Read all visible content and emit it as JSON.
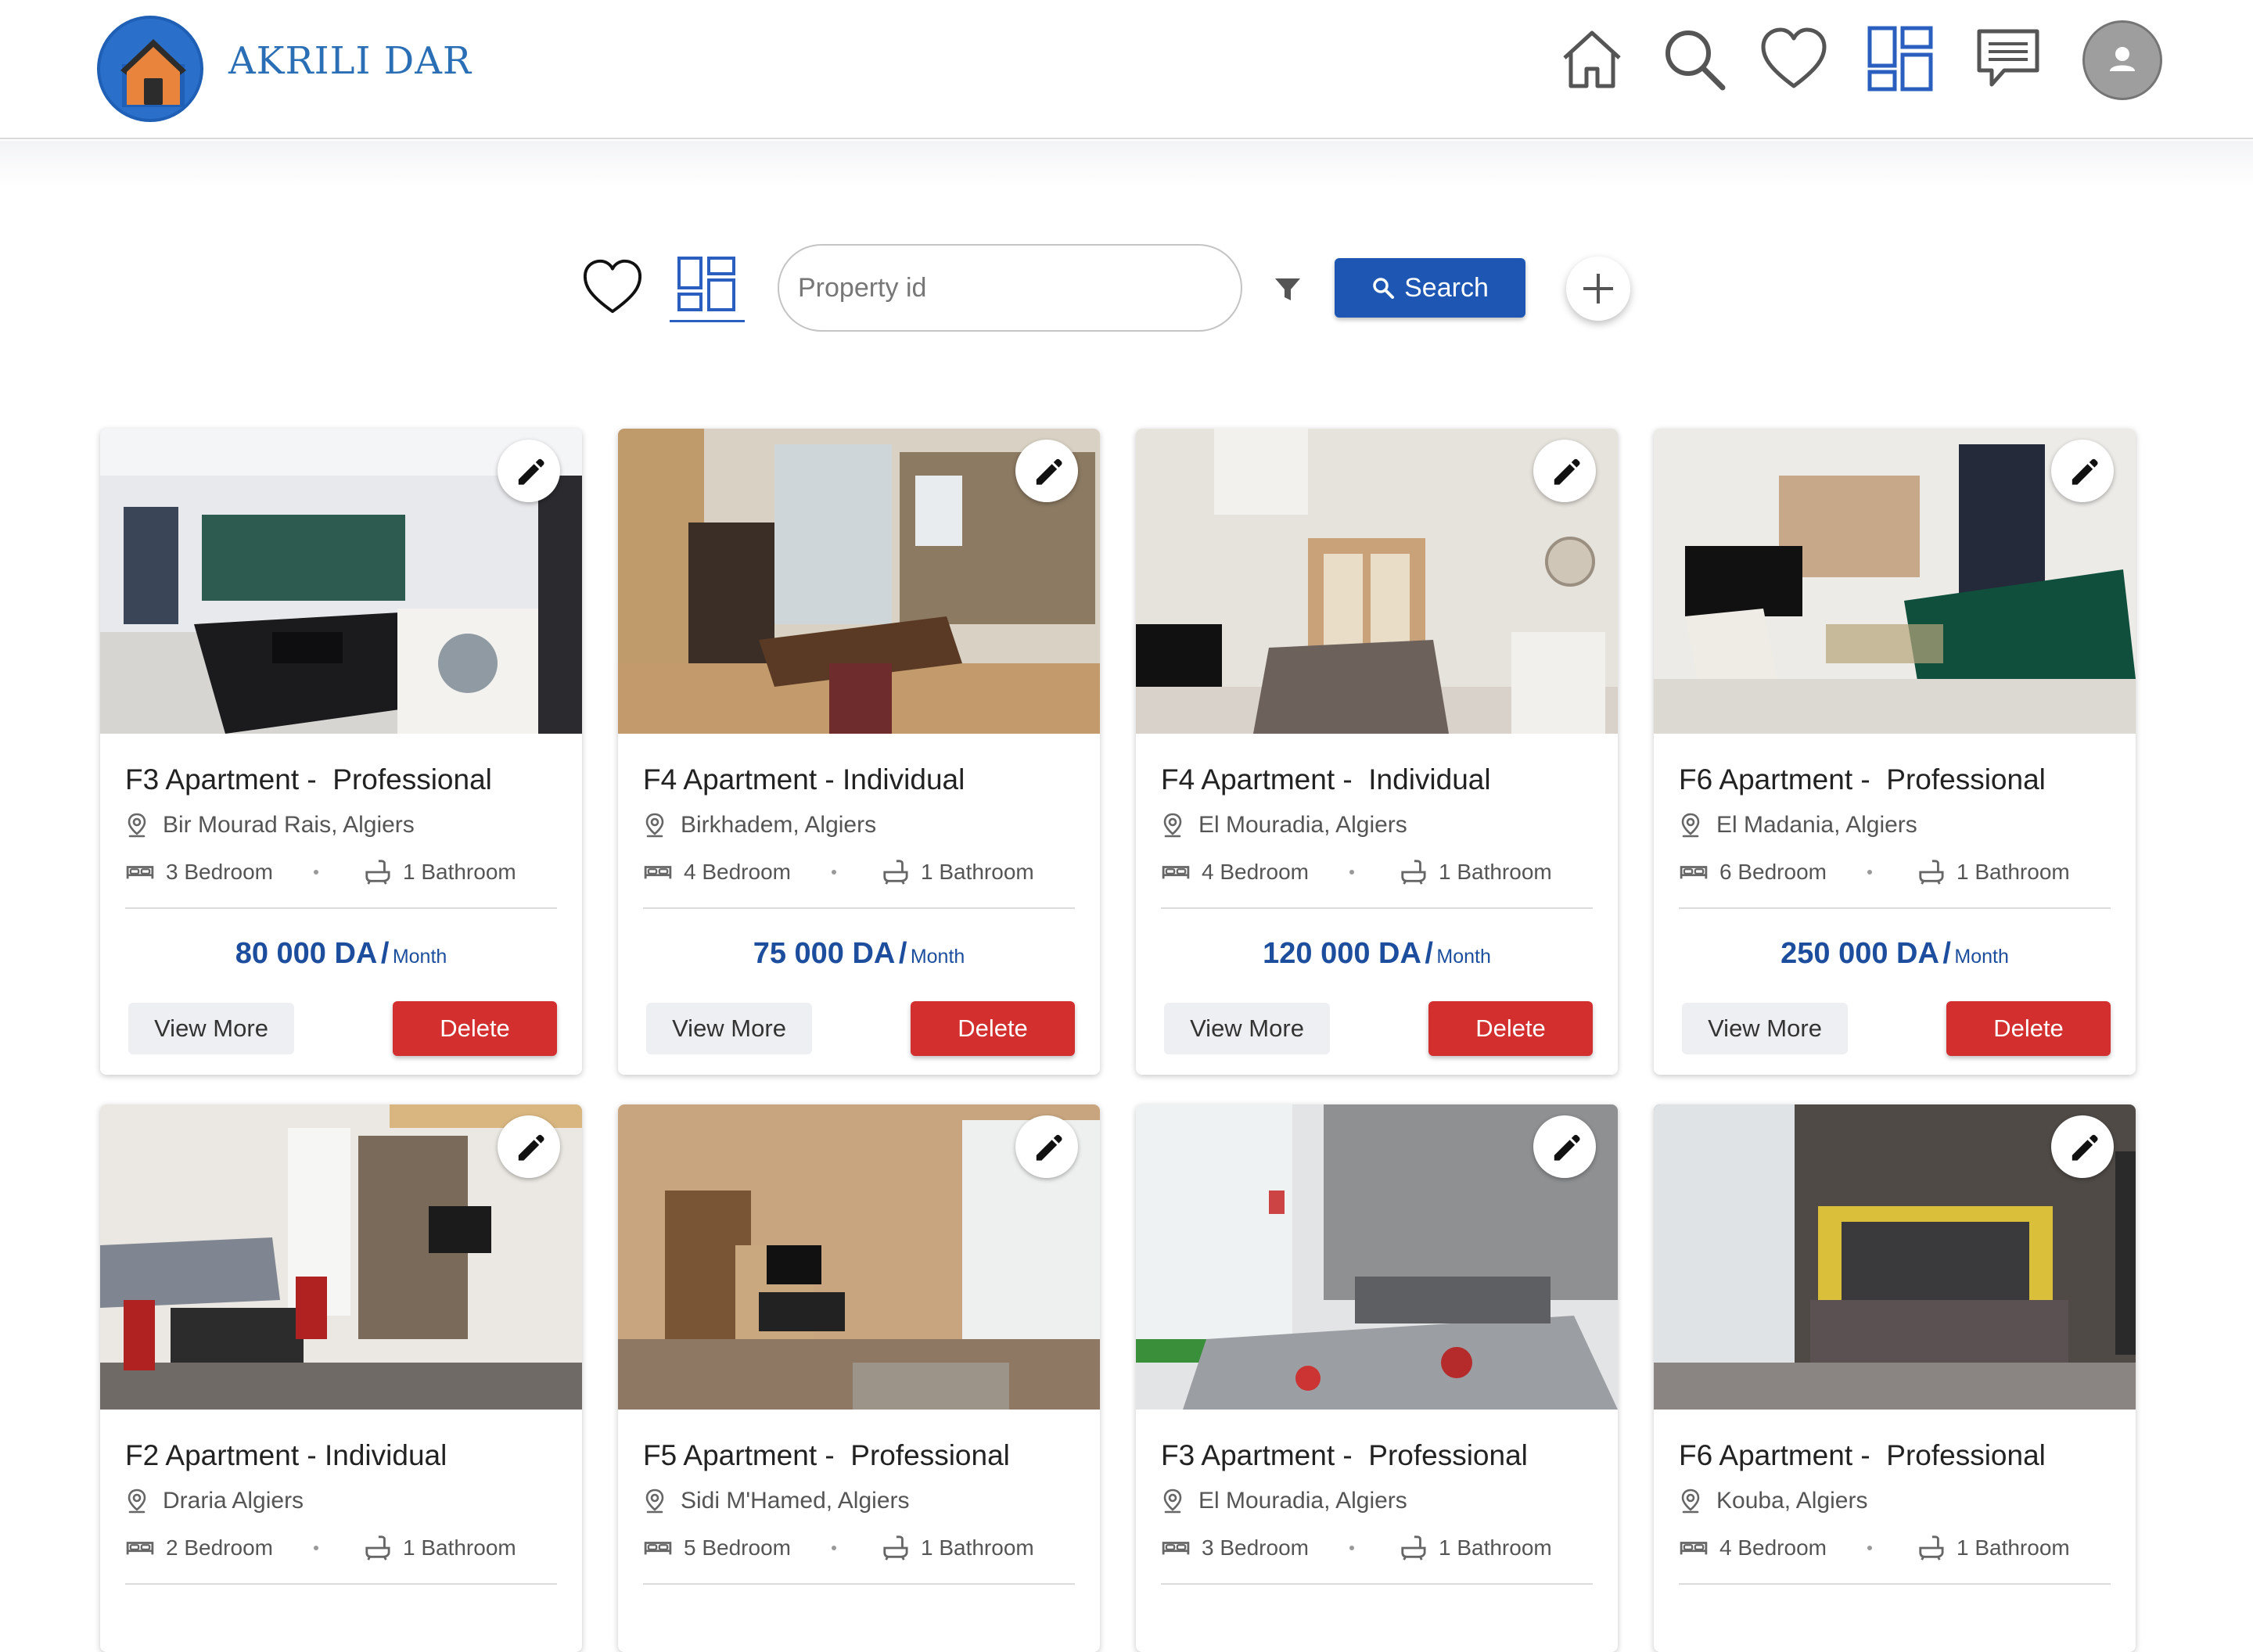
{
  "brand": {
    "name": "AKRILI DAR",
    "colors": {
      "primary": "#1d56b3",
      "logo": "#2a6fc9",
      "roof": "#e8843c",
      "danger": "#d32f2f",
      "price": "#1d4e9e"
    }
  },
  "nav": {
    "icons": [
      "home-icon",
      "search-icon",
      "heart-icon",
      "dashboard-icon",
      "chat-icon",
      "user-avatar"
    ],
    "active": "dashboard-icon"
  },
  "toolbar": {
    "search_placeholder": "Property id",
    "search_label": "Search"
  },
  "listings": [
    {
      "title": "F3 Apartment -  Professional",
      "location": "Bir Mourad Rais, Algiers",
      "bedrooms": "3 Bedroom",
      "bathrooms": "1 Bathroom",
      "price": "80 000 DA",
      "slash": "/",
      "period": "Month",
      "view_label": "View More",
      "delete_label": "Delete"
    },
    {
      "title": "F4 Apartment - Individual",
      "location": "Birkhadem, Algiers",
      "bedrooms": "4 Bedroom",
      "bathrooms": "1 Bathroom",
      "price": "75 000 DA",
      "slash": "/",
      "period": "Month",
      "view_label": "View More",
      "delete_label": "Delete"
    },
    {
      "title": "F4 Apartment -  Individual",
      "location": "El Mouradia, Algiers",
      "bedrooms": "4 Bedroom",
      "bathrooms": "1 Bathroom",
      "price": "120 000 DA",
      "slash": "/",
      "period": "Month",
      "view_label": "View More",
      "delete_label": "Delete"
    },
    {
      "title": "F6 Apartment -  Professional",
      "location": "El Madania, Algiers",
      "bedrooms": "6 Bedroom",
      "bathrooms": "1 Bathroom",
      "price": "250 000 DA",
      "slash": "/",
      "period": "Month",
      "view_label": "View More",
      "delete_label": "Delete"
    },
    {
      "title": "F2 Apartment - Individual",
      "location": "Draria Algiers",
      "bedrooms": "2 Bedroom",
      "bathrooms": "1 Bathroom"
    },
    {
      "title": "F5 Apartment -  Professional",
      "location": "Sidi M'Hamed, Algiers",
      "bedrooms": "5 Bedroom",
      "bathrooms": "1 Bathroom"
    },
    {
      "title": "F3 Apartment -  Professional",
      "location": "El Mouradia, Algiers",
      "bedrooms": "3 Bedroom",
      "bathrooms": "1 Bathroom"
    },
    {
      "title": "F6 Apartment -  Professional",
      "location": "Kouba, Algiers",
      "bedrooms": "4 Bedroom",
      "bathrooms": "1 Bathroom"
    }
  ]
}
